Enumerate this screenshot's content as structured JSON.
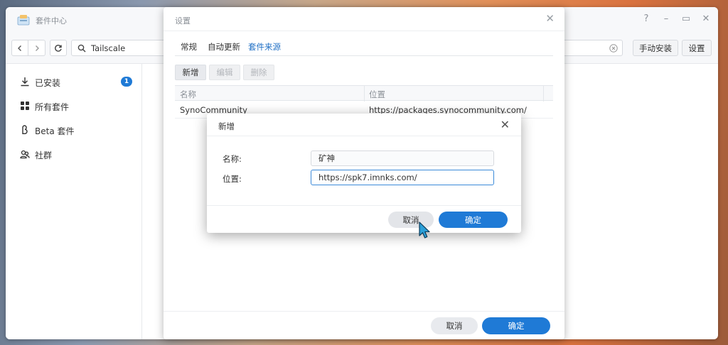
{
  "app": {
    "title": "套件中心",
    "search": {
      "value": "Tailscale"
    },
    "buttons": {
      "manual_install": "手动安装",
      "settings": "设置"
    },
    "sidebar": {
      "items": [
        {
          "label": "已安装",
          "icon": "download-icon",
          "badge": "1"
        },
        {
          "label": "所有套件",
          "icon": "grid-icon"
        },
        {
          "label": "Beta 套件",
          "icon": "beta-icon"
        },
        {
          "label": "社群",
          "icon": "community-icon"
        }
      ]
    }
  },
  "settings_dialog": {
    "title": "设置",
    "tabs": [
      "常规",
      "自动更新",
      "套件来源"
    ],
    "active_tab": "套件来源",
    "toolbar": {
      "add": "新增",
      "edit": "编辑",
      "delete": "删除"
    },
    "table": {
      "columns": [
        "名称",
        "位置"
      ],
      "rows": [
        {
          "name": "SynoCommunity",
          "location": "https://packages.synocommunity.com/"
        }
      ]
    },
    "footer": {
      "cancel": "取消",
      "ok": "确定"
    }
  },
  "add_dialog": {
    "title": "新增",
    "fields": {
      "name": {
        "label": "名称:",
        "value": "矿神"
      },
      "location": {
        "label": "位置:",
        "value": "https://spk7.imnks.com/"
      }
    },
    "footer": {
      "cancel": "取消",
      "ok": "确定"
    }
  },
  "colors": {
    "accent": "#1f7ad6",
    "focus": "#3b8ad9"
  }
}
